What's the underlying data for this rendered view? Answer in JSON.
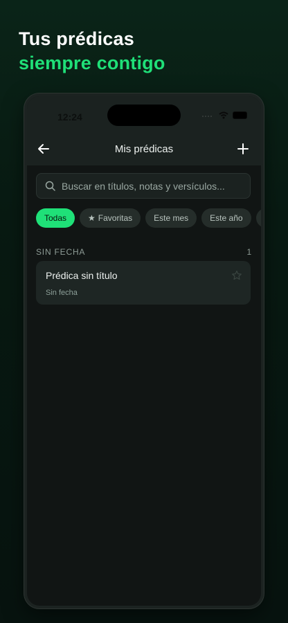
{
  "hero": {
    "line1": "Tus prédicas",
    "line2": "siempre contigo"
  },
  "status_bar": {
    "time": "12:24"
  },
  "nav": {
    "title": "Mis prédicas"
  },
  "search": {
    "placeholder": "Buscar en títulos, notas y versículos..."
  },
  "filters": [
    {
      "label": "Todas",
      "active": true
    },
    {
      "label": "Favoritas",
      "icon": "star-icon"
    },
    {
      "label": "Este mes"
    },
    {
      "label": "Este año"
    }
  ],
  "section": {
    "title": "SIN FECHA",
    "count": "1"
  },
  "sermons": [
    {
      "title": "Prédica sin título",
      "date": "Sin fecha",
      "favorite": false
    }
  ],
  "colors": {
    "accent": "#1fe078",
    "background": "#111514",
    "surface": "#1e2624"
  }
}
